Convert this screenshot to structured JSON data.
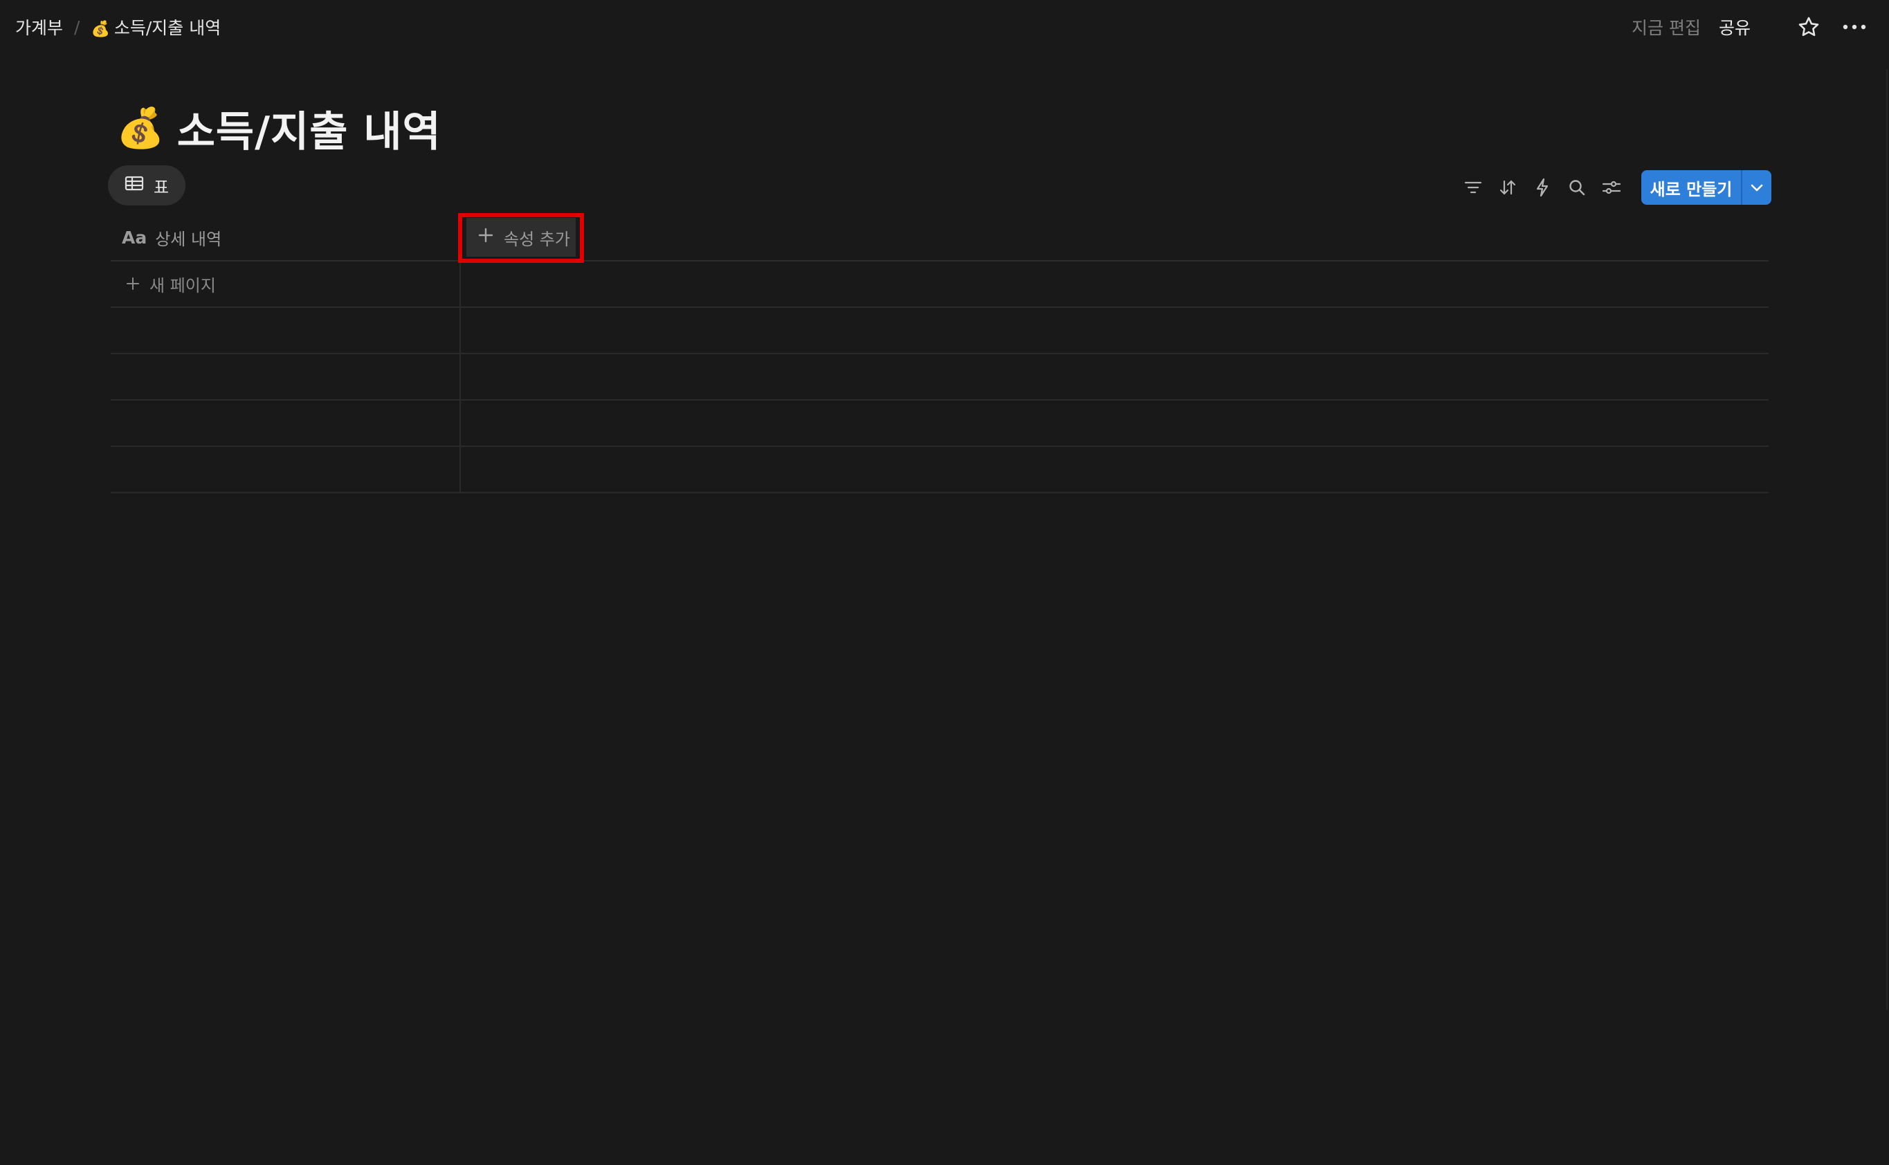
{
  "breadcrumb": {
    "parent": "가계부",
    "separator": "/",
    "current_emoji": "💰",
    "current": "소득/지출 내역"
  },
  "topbar": {
    "edited": "지금 편집",
    "share": "공유"
  },
  "page": {
    "emoji": "💰",
    "title": "소득/지출 내역"
  },
  "view": {
    "tab_label": "표"
  },
  "toolbar": {
    "new_button": "새로 만들기"
  },
  "table": {
    "column_title_icon": "Aa",
    "column_title": "상세 내역",
    "add_property": "속성 추가",
    "new_page": "새 페이지"
  },
  "colors": {
    "background": "#191919",
    "accent": "#2e7fd9",
    "highlight": "#e00000"
  }
}
